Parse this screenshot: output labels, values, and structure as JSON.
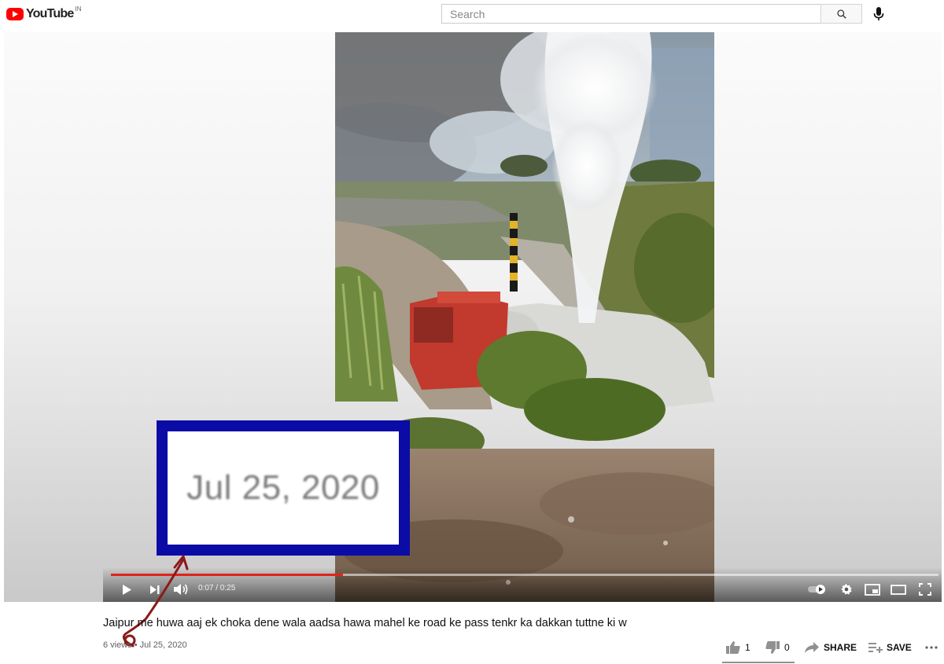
{
  "header": {
    "logo_text": "YouTube",
    "country_code": "IN",
    "search_placeholder": "Search"
  },
  "player": {
    "current_time": "0:07",
    "duration": "0:25",
    "time_display": "0:07 / 0:25",
    "progress_fraction": 0.28
  },
  "overlay": {
    "zoom_text": "Jul 25, 2020",
    "box_color": "#0b0ba6",
    "arrow_color": "#8b1a1a"
  },
  "video": {
    "title": "Jaipur me huwa aaj ek choka dene wala aadsa hawa mahel ke road ke pass tenkr ka dakkan tuttne ki w",
    "views": "6 views",
    "separator": "•",
    "date": "Jul 25, 2020"
  },
  "actions": {
    "likes": "1",
    "dislikes": "0",
    "share_label": "SHARE",
    "save_label": "SAVE"
  },
  "colors": {
    "brand_red": "#ff0000",
    "progress_red": "#e0241b"
  }
}
